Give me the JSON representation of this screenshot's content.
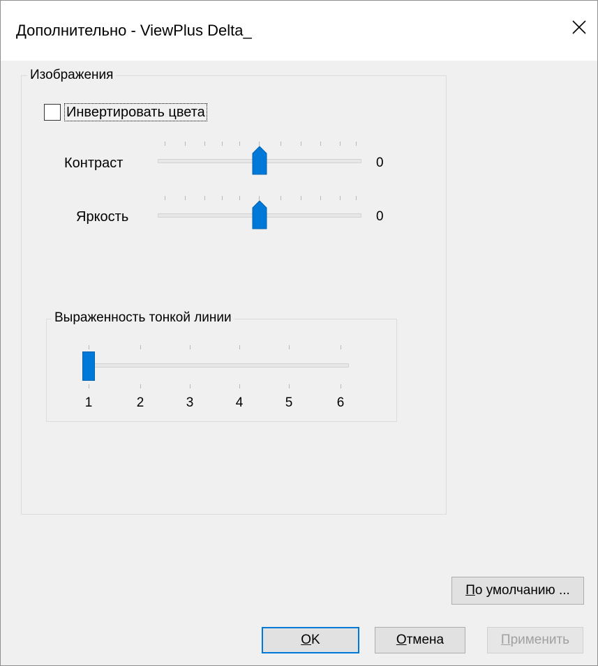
{
  "window": {
    "title": "Дополнительно - ViewPlus Delta_",
    "close_glyph": "✕"
  },
  "images_group": {
    "label": "Изображения",
    "invert_checkbox": {
      "label": "Инвертировать цвета",
      "checked": false
    },
    "contrast": {
      "label": "Контраст",
      "value": "0",
      "level": 0
    },
    "brightness": {
      "label": "Яркость",
      "value": "0",
      "level": 0
    }
  },
  "line_group": {
    "label": "Выраженность тонкой линии",
    "tick_labels": [
      "1",
      "2",
      "3",
      "4",
      "5",
      "6"
    ],
    "selected": 1
  },
  "buttons": {
    "defaults": {
      "accel": "П",
      "rest": "о умолчанию ..."
    },
    "ok": {
      "accel": "О",
      "rest": "K"
    },
    "cancel": {
      "accel": "О",
      "rest": "тмена"
    },
    "apply": {
      "accel": "П",
      "rest": "рименить",
      "enabled": false
    }
  },
  "colors": {
    "accent": "#0078d7",
    "window_bg": "#f0f0f0"
  }
}
